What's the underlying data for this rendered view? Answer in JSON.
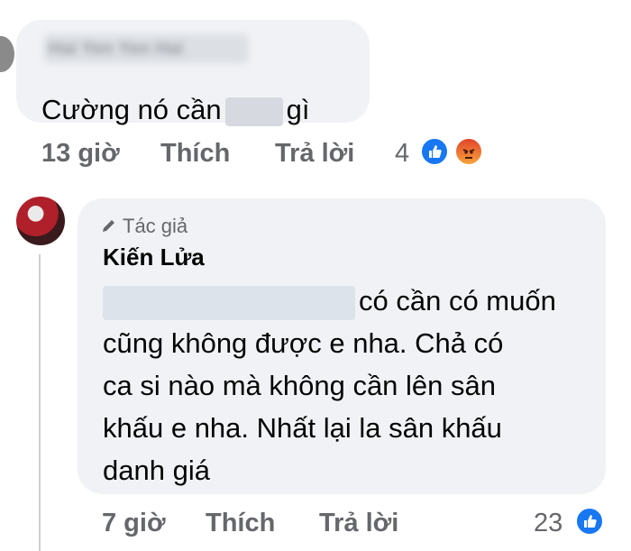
{
  "comment1": {
    "author": "Hai Yen Yen Hai",
    "text_before": "Cường nó cần",
    "text_after": "gì",
    "time": "13 giờ",
    "like_label": "Thích",
    "reply_label": "Trả lời",
    "reaction_count": "4",
    "reactions": [
      "like-icon",
      "angry-icon"
    ]
  },
  "comment2": {
    "badge": "Tác giả",
    "author": "Kiến Lửa",
    "lines": [
      "có cần có muốn",
      "cũng không được e nha. Chả có",
      "ca si nào mà không cần lên sân",
      "khấu e nha. Nhất lại la sân khấu",
      "danh giá"
    ],
    "time": "7 giờ",
    "like_label": "Thích",
    "reply_label": "Trả lời",
    "reaction_count": "23",
    "reactions": [
      "like-icon"
    ]
  },
  "colors": {
    "bubble": "#f0f2f5",
    "meta": "#65676b",
    "like": "#1877f2",
    "text": "#050505"
  }
}
